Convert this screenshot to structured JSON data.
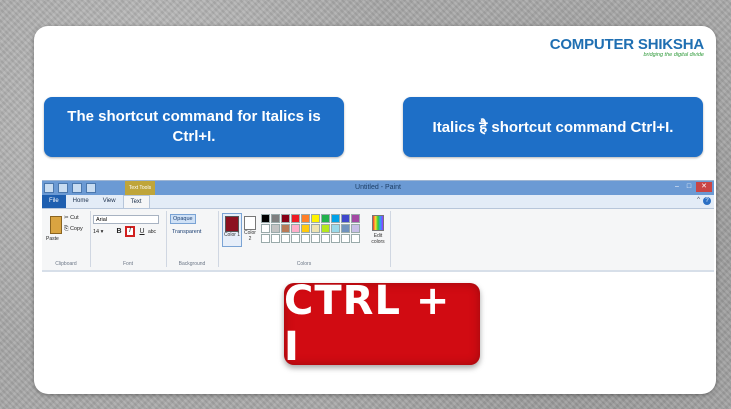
{
  "logo": {
    "main": "COMPUTER SHIKSHA",
    "tagline": "bridging the digital divide"
  },
  "bubbles": {
    "english": "The shortcut command for Italics is Ctrl+I.",
    "hindi": "Italics है shortcut command Ctrl+I."
  },
  "paint": {
    "window_title": "Untitled - Paint",
    "context_tab": "Text Tools",
    "tabs": [
      "File",
      "Home",
      "View",
      "Text"
    ],
    "active_tab": "Text",
    "clipboard": {
      "paste": "Paste",
      "cut": "Cut",
      "copy": "Copy",
      "group_label": "Clipboard"
    },
    "font": {
      "family": "Arial",
      "size": "14",
      "bold": "B",
      "italic": "I",
      "underline": "U",
      "strike": "abc",
      "group_label": "Font"
    },
    "background": {
      "opaque": "Opaque",
      "transparent": "Transparent",
      "group_label": "Background"
    },
    "colors": {
      "color1": "Color 1",
      "color2": "Color 2",
      "edit": "Edit colors",
      "group_label": "Colors",
      "color1_value": "#8c1020",
      "palette_row1": [
        "#000000",
        "#7f7f7f",
        "#880015",
        "#ed1c24",
        "#ff7f27",
        "#fff200",
        "#22b14c",
        "#00a2e8",
        "#3f48cc",
        "#a349a4"
      ],
      "palette_row2": [
        "#ffffff",
        "#c3c3c3",
        "#b97a57",
        "#ffaec9",
        "#ffc90e",
        "#efe4b0",
        "#b5e61d",
        "#99d9ea",
        "#7092be",
        "#c8bfe7"
      ],
      "palette_row3": [
        "#ffffff",
        "#ffffff",
        "#ffffff",
        "#ffffff",
        "#ffffff",
        "#ffffff",
        "#ffffff",
        "#ffffff",
        "#ffffff",
        "#ffffff"
      ]
    }
  },
  "shortcut": "CTRL + I",
  "colors": {
    "bubble": "#1e6fc7",
    "badge": "#d10b12",
    "highlight": "#d1201f"
  }
}
